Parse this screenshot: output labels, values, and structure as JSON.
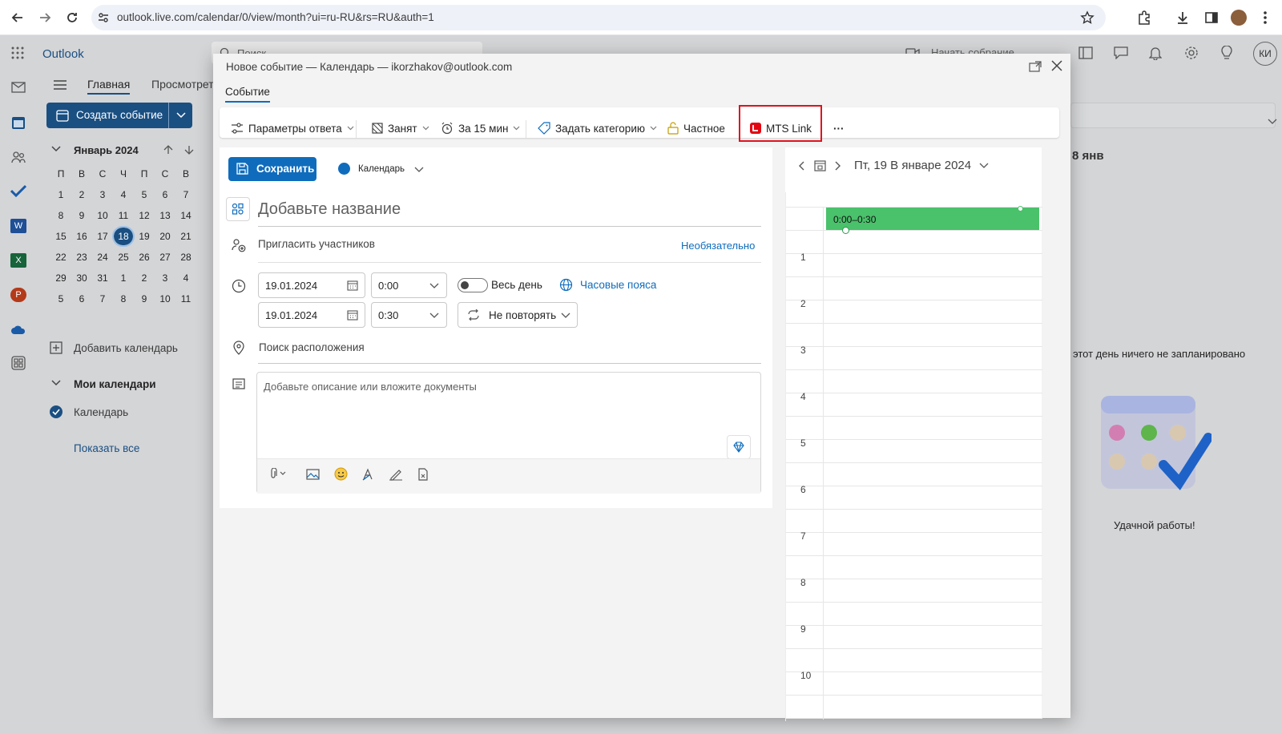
{
  "browser": {
    "url": "outlook.live.com/calendar/0/view/month?ui=ru-RU&rs=RU&auth=1"
  },
  "outlook": {
    "app_name": "Outlook",
    "tabs": [
      "Главная",
      "Просмотреть"
    ],
    "create_event": "Создать событие",
    "search_placeholder": "Поиск",
    "meet_now": "Начать собрание",
    "user_initials": "КИ",
    "mini_calendar": {
      "month_label": "Январь 2024",
      "weekdays": [
        "П",
        "В",
        "С",
        "Ч",
        "П",
        "С",
        "В"
      ],
      "weeks": [
        [
          "1",
          "2",
          "3",
          "4",
          "5",
          "6",
          "7"
        ],
        [
          "8",
          "9",
          "10",
          "11",
          "12",
          "13",
          "14"
        ],
        [
          "15",
          "16",
          "17",
          "18",
          "19",
          "20",
          "21"
        ],
        [
          "22",
          "23",
          "24",
          "25",
          "26",
          "27",
          "28"
        ],
        [
          "29",
          "30",
          "31",
          "1",
          "2",
          "3",
          "4"
        ],
        [
          "5",
          "6",
          "7",
          "8",
          "9",
          "10",
          "11"
        ]
      ],
      "today": "18"
    },
    "add_calendar": "Добавить календарь",
    "my_calendars": "Мои календари",
    "calendar_item": "Календарь",
    "show_all": "Показать все",
    "right_panel": {
      "date_header": "8 янв",
      "empty_text": "этот день ничего не запланировано",
      "good_luck": "Удачной работы!"
    }
  },
  "modal": {
    "title": "Новое событие — Календарь — ikorzhakov@outlook.com",
    "tab": "Событие",
    "toolbar": {
      "response_options": "Параметры ответа",
      "busy": "Занят",
      "reminder": "За 15 мин",
      "category": "Задать категорию",
      "private": "Частное",
      "mts_link": "MTS Link",
      "more": "···"
    },
    "save": "Сохранить",
    "calendar_select": "Календарь",
    "title_placeholder": "Добавьте название",
    "invite": "Пригласить участников",
    "optional": "Необязательно",
    "start_date": "19.01.2024",
    "start_time": "0:00",
    "end_date": "19.01.2024",
    "end_time": "0:30",
    "all_day": "Весь день",
    "timezones": "Часовые пояса",
    "repeat": "Не повторять",
    "location_placeholder": "Поиск расположения",
    "description_placeholder": "Добавьте описание или вложите документы",
    "day_view": {
      "date_label": "Пт, 19 В январе 2024",
      "event_time": "0:00–0:30",
      "hours": [
        "1",
        "2",
        "3",
        "4",
        "5",
        "6",
        "7",
        "8",
        "9",
        "10"
      ]
    }
  },
  "colors": {
    "primary": "#0f6cbd",
    "event_green": "#4ac16b",
    "mts_red": "#e30611",
    "highlight_border": "#e0131f"
  }
}
